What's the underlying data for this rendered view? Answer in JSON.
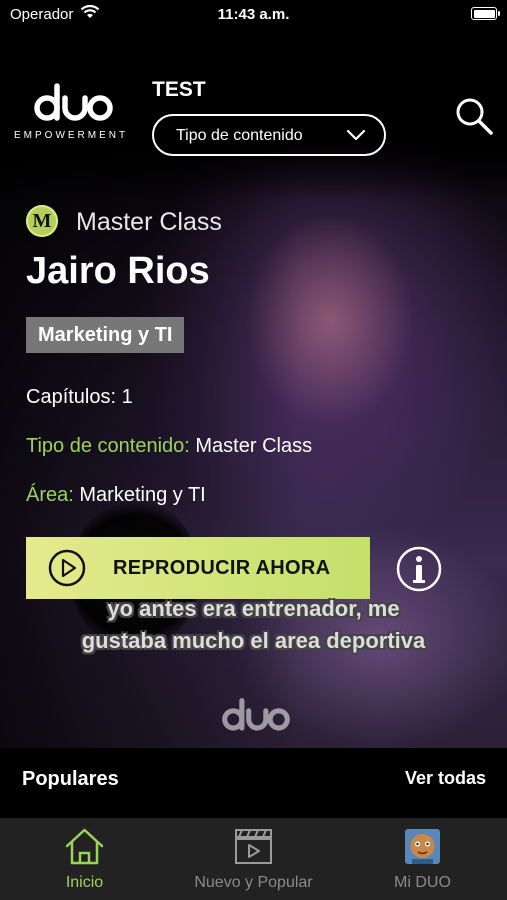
{
  "status_bar": {
    "carrier": "Operador",
    "time": "11:43 a.m."
  },
  "header": {
    "logo_text": "EMPOWERMENT",
    "profile_label": "TEST",
    "content_type_select": {
      "selected": "Tipo de contenido"
    }
  },
  "hero": {
    "badge_letter": "M",
    "category": "Master Class",
    "title": "Jairo Rios",
    "tag": "Marketing y TI",
    "chapters": "Capítulos: 1",
    "content_type_label": "Tipo de contenido:",
    "content_type_value": "Master Class",
    "area_label": "Área:",
    "area_value": "Marketing y TI",
    "play_button_label": "REPRODUCIR AHORA",
    "caption_line1": "yo antes era entrenador, me",
    "caption_line2": "gustaba mucho el area deportiva"
  },
  "section": {
    "title": "Populares",
    "see_all": "Ver todas"
  },
  "tabbar": {
    "tabs": [
      {
        "label": "Inicio",
        "icon": "home-icon",
        "active": true
      },
      {
        "label": "Nuevo y Popular",
        "icon": "clapperboard-icon",
        "active": false
      },
      {
        "label": "Mi DUO",
        "icon": "avatar-icon",
        "active": false
      }
    ]
  },
  "colors": {
    "accent_green": "#9ad45a",
    "play_button": "#dbe67e",
    "tab_background": "#222222"
  }
}
